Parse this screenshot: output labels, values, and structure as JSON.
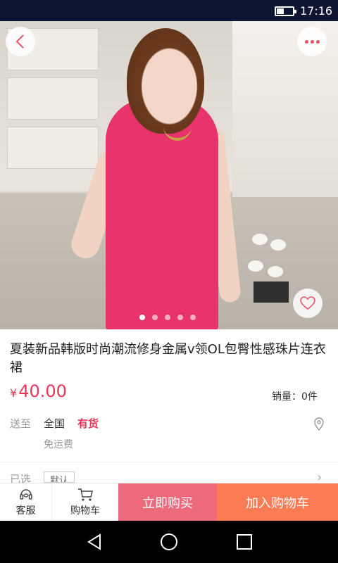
{
  "status_bar": {
    "time": "17:16",
    "battery_level": 0.45
  },
  "product": {
    "title": "夏装新品韩版时尚潮流修身金属v领OL包臀性感珠片连衣裙",
    "price_symbol": "¥",
    "price": "40.00",
    "sales": "销量：0件",
    "image_count": 5,
    "image_index": 0
  },
  "shipping": {
    "label": "送至",
    "area": "全国",
    "stock": "有货",
    "fee": "免运费"
  },
  "selection": {
    "label": "已选",
    "value": "默认"
  },
  "bottom_bar": {
    "service_label": "客服",
    "cart_label": "购物车",
    "buy_now_label": "立即购买",
    "add_cart_label": "加入购物车"
  },
  "icons": {
    "back": "chevron-left-icon",
    "more": "more-dots-icon",
    "favorite": "heart-icon",
    "location": "location-pin-icon",
    "service": "headset-icon",
    "cart": "cart-icon"
  },
  "colors": {
    "accent": "#e8365a",
    "buy_now": "#ec6a7c",
    "add_cart": "#fa7b54",
    "status_bar": "#0d1533"
  }
}
